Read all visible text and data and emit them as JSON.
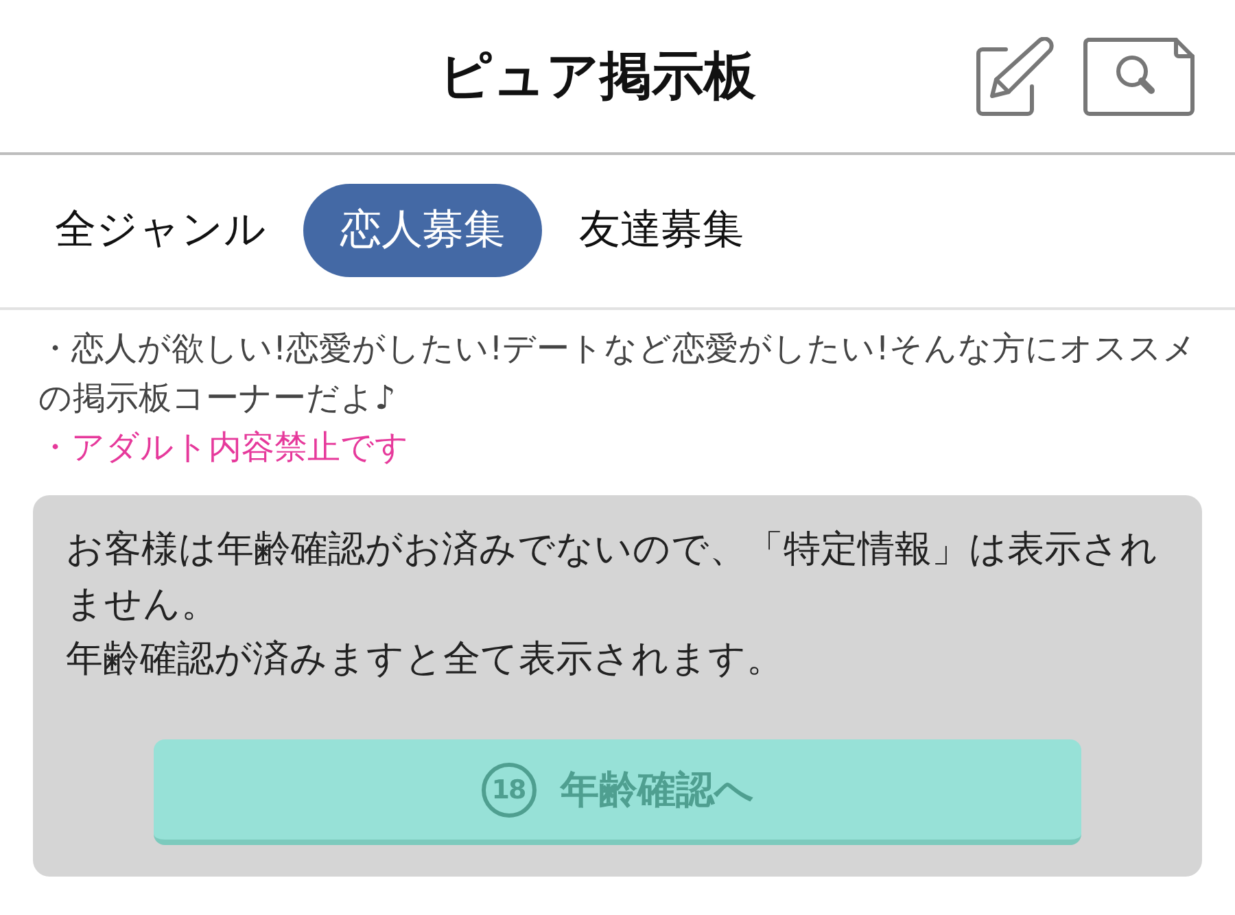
{
  "header": {
    "title": "ピュア掲示板"
  },
  "tabs": [
    {
      "label": "全ジャンル",
      "selected": false
    },
    {
      "label": "恋人募集",
      "selected": true
    },
    {
      "label": "友達募集",
      "selected": false
    }
  ],
  "notes": [
    {
      "kind": "info",
      "text": "・恋人が欲しい!恋愛がしたい!デートなど恋愛がしたい!そんな方にオススメの掲示板コーナーだよ♪"
    },
    {
      "kind": "warning",
      "text": "・アダルト内容禁止です"
    }
  ],
  "age_notice": {
    "lines": [
      "お客様は年齢確認がお済みでないので、「特定情報」は表示されません。",
      "年齢確認が済みますと全て表示されます。"
    ],
    "button": {
      "badge": "18",
      "label": "年齢確認へ"
    }
  }
}
